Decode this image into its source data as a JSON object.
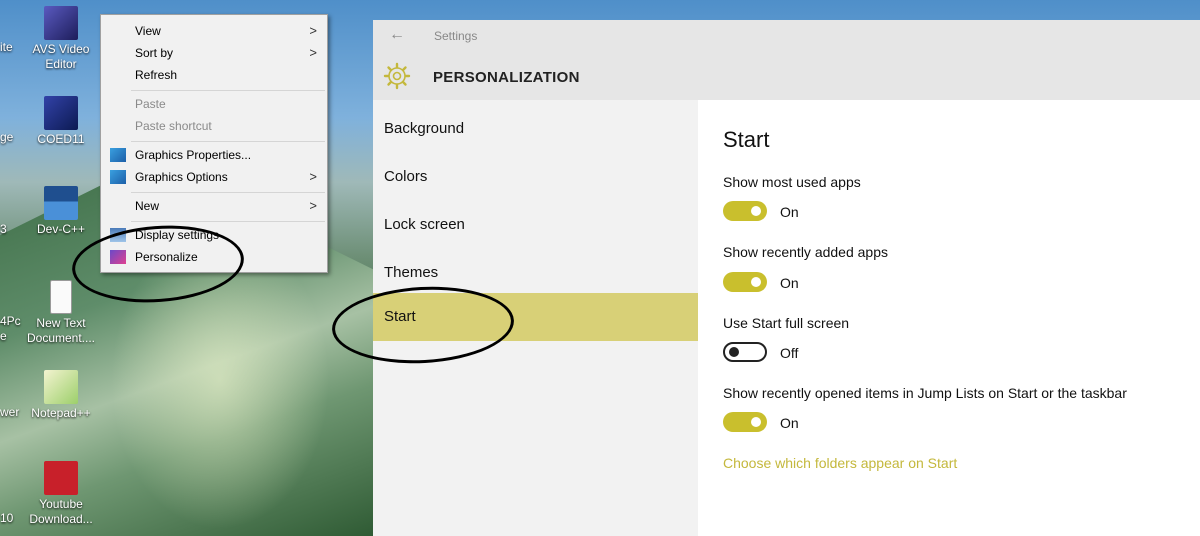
{
  "desktop": {
    "icons": [
      {
        "label": "AVS Video Editor",
        "icon": "avs-video-editor-icon",
        "color": "#3b3b8f"
      },
      {
        "label": "COED11",
        "icon": "coed-icon",
        "color": "#1b2f7a"
      },
      {
        "label": "Dev-C++",
        "icon": "devcpp-icon",
        "color": "#2c6bb5"
      },
      {
        "label": "New Text Document....",
        "icon": "text-file-icon",
        "color": "#ffffff"
      },
      {
        "label": "Notepad++",
        "icon": "notepadpp-icon",
        "color": "#e8e8c8"
      },
      {
        "label": "Youtube Download...",
        "icon": "youtube-downloader-icon",
        "color": "#c8202a"
      }
    ],
    "edge_texts": [
      "ite",
      "ge",
      "3",
      "4Pc",
      "e",
      "wer",
      "10"
    ]
  },
  "context_menu": {
    "items": [
      {
        "label": "View",
        "submenu": true,
        "disabled": false
      },
      {
        "label": "Sort by",
        "submenu": true,
        "disabled": false
      },
      {
        "label": "Refresh",
        "submenu": false,
        "disabled": false
      },
      {
        "label": "Paste",
        "submenu": false,
        "disabled": true
      },
      {
        "label": "Paste shortcut",
        "submenu": false,
        "disabled": true
      },
      {
        "label": "Graphics Properties...",
        "submenu": false,
        "disabled": false,
        "icon": "graphics-icon"
      },
      {
        "label": "Graphics Options",
        "submenu": true,
        "disabled": false,
        "icon": "graphics-icon"
      },
      {
        "label": "New",
        "submenu": true,
        "disabled": false
      },
      {
        "label": "Display settings",
        "submenu": false,
        "disabled": false,
        "icon": "display-icon"
      },
      {
        "label": "Personalize",
        "submenu": false,
        "disabled": false,
        "icon": "personalize-icon"
      }
    ],
    "arrow_glyph": ">"
  },
  "settings": {
    "window_title": "Settings",
    "back_glyph": "←",
    "header_title": "PERSONALIZATION",
    "nav": [
      {
        "label": "Background",
        "active": false
      },
      {
        "label": "Colors",
        "active": false
      },
      {
        "label": "Lock screen",
        "active": false
      },
      {
        "label": "Themes",
        "active": false
      },
      {
        "label": "Start",
        "active": true
      }
    ],
    "content_title": "Start",
    "options": [
      {
        "label": "Show most used apps",
        "state": "On",
        "on": true
      },
      {
        "label": "Show recently added apps",
        "state": "On",
        "on": true
      },
      {
        "label": "Use Start full screen",
        "state": "Off",
        "on": false
      },
      {
        "label": "Show recently opened items in Jump Lists on Start or the taskbar",
        "state": "On",
        "on": true
      }
    ],
    "link": "Choose which folders appear on Start",
    "accent": "#c9bf2d",
    "nav_active_color": "#d8d077"
  }
}
